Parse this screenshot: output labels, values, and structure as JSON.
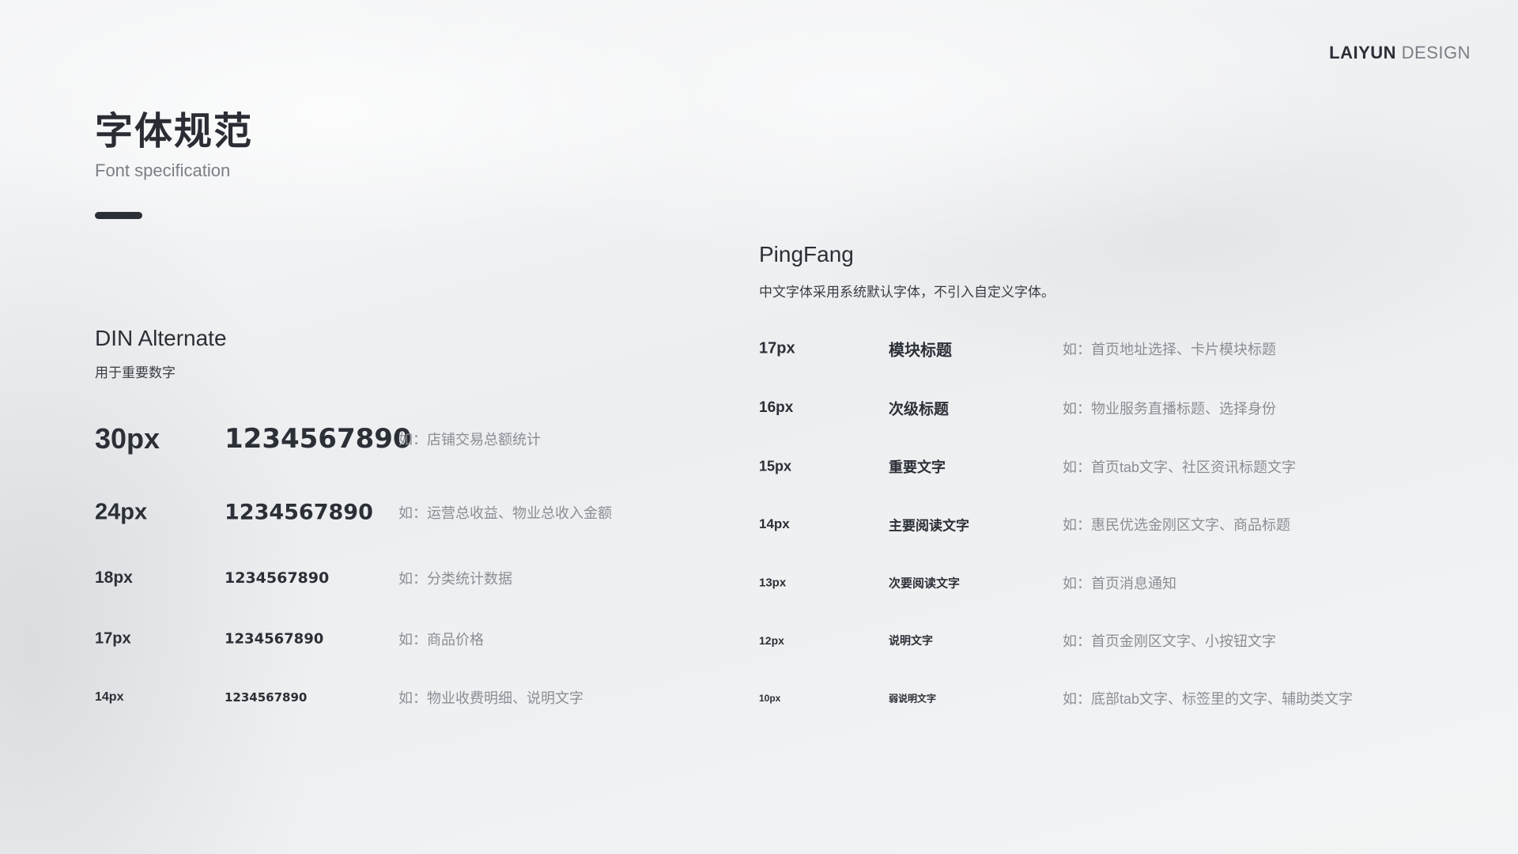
{
  "brand": {
    "primary": "LAIYUN",
    "secondary": "DESIGN"
  },
  "title": "字体规范",
  "subtitle": "Font specification",
  "left": {
    "heading": "DIN Alternate",
    "description": "用于重要数字",
    "rows": [
      {
        "size": "30px",
        "sample": "1234567890",
        "example": "如：店铺交易总额统计"
      },
      {
        "size": "24px",
        "sample": "1234567890",
        "example": "如：运营总收益、物业总收入金额"
      },
      {
        "size": "18px",
        "sample": "1234567890",
        "example": "如：分类统计数据"
      },
      {
        "size": "17px",
        "sample": "1234567890",
        "example": "如：商品价格"
      },
      {
        "size": "14px",
        "sample": "1234567890",
        "example": "如：物业收费明细、说明文字"
      }
    ]
  },
  "right": {
    "heading": "PingFang",
    "description": "中文字体采用系统默认字体，不引入自定义字体。",
    "rows": [
      {
        "size": "17px",
        "sample": "模块标题",
        "example": "如：首页地址选择、卡片模块标题"
      },
      {
        "size": "16px",
        "sample": "次级标题",
        "example": "如：物业服务直播标题、选择身份"
      },
      {
        "size": "15px",
        "sample": "重要文字",
        "example": "如：首页tab文字、社区资讯标题文字"
      },
      {
        "size": "14px",
        "sample": "主要阅读文字",
        "example": "如：惠民优选金刚区文字、商品标题"
      },
      {
        "size": "13px",
        "sample": "次要阅读文字",
        "example": "如：首页消息通知"
      },
      {
        "size": "12px",
        "sample": "说明文字",
        "example": "如：首页金刚区文字、小按钮文字"
      },
      {
        "size": "10px",
        "sample": "弱说明文字",
        "example": "如：底部tab文字、标签里的文字、辅助类文字"
      }
    ]
  },
  "colors": {
    "text_dark": "#2b2f36",
    "text_muted": "#8a8e94",
    "background": "#f1f2f4"
  }
}
